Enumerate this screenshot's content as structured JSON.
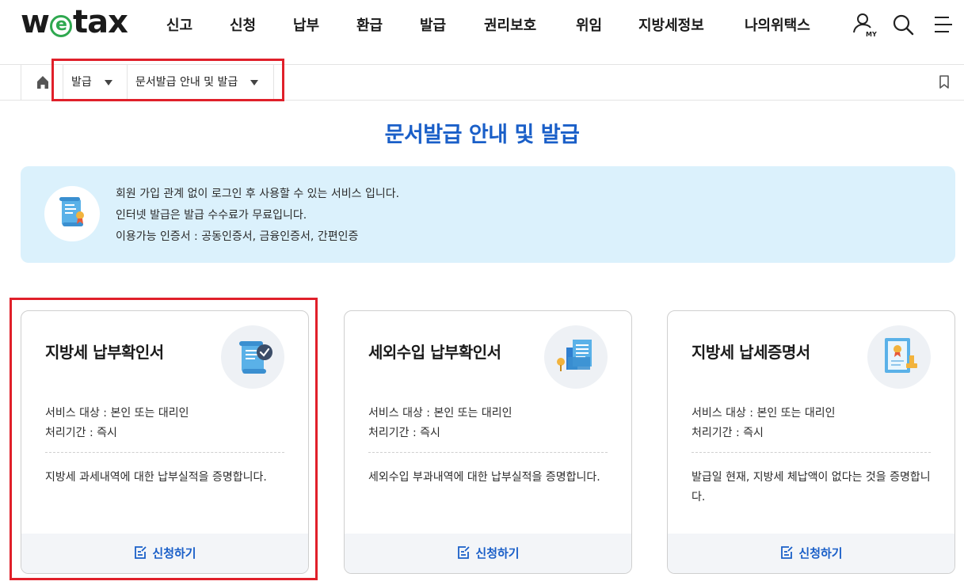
{
  "header": {
    "logo_text": "wetax",
    "nav": [
      "신고",
      "신청",
      "납부",
      "환급",
      "발급",
      "권리보호",
      "위임",
      "지방세정보",
      "나의위택스"
    ],
    "my_label": "MY",
    "icons": [
      "user-my-icon",
      "search-icon",
      "menu-icon"
    ]
  },
  "breadcrumb": {
    "level1": "발급",
    "level2": "문서발급 안내 및 발급"
  },
  "page": {
    "title": "문서발급 안내 및 발급"
  },
  "info": {
    "lines": [
      "회원 가입 관계 없이 로그인 후 사용할 수 있는 서비스 입니다.",
      "인터넷 발급은 발급 수수료가 무료입니다.",
      "이용가능 인증서 : 공동인증서, 금융인증서, 간편인증"
    ]
  },
  "cards": [
    {
      "title": "지방세 납부확인서",
      "target": "서비스 대상 : 본인 또는 대리인",
      "period": "처리기간 : 즉시",
      "desc": "지방세 과세내역에 대한 납부실적을 증명합니다.",
      "button": "신청하기",
      "icon": "document-check-icon"
    },
    {
      "title": "세외수입 납부확인서",
      "target": "서비스 대상 : 본인 또는 대리인",
      "period": "처리기간 : 즉시",
      "desc": "세외수입 부과내역에 대한 납부실적을 증명합니다.",
      "button": "신청하기",
      "icon": "building-documents-icon"
    },
    {
      "title": "지방세 납세증명서",
      "target": "서비스 대상 : 본인 또는 대리인",
      "period": "처리기간 : 즉시",
      "desc": "발급일 현재, 지방세 체납액이 없다는 것을 증명합니다.",
      "button": "신청하기",
      "icon": "certificate-stamp-icon"
    }
  ],
  "colors": {
    "accent": "#1a5fc8",
    "info_bg": "#dbf1fc",
    "highlight": "#e0202a",
    "logo_e": "#2fa84f"
  }
}
